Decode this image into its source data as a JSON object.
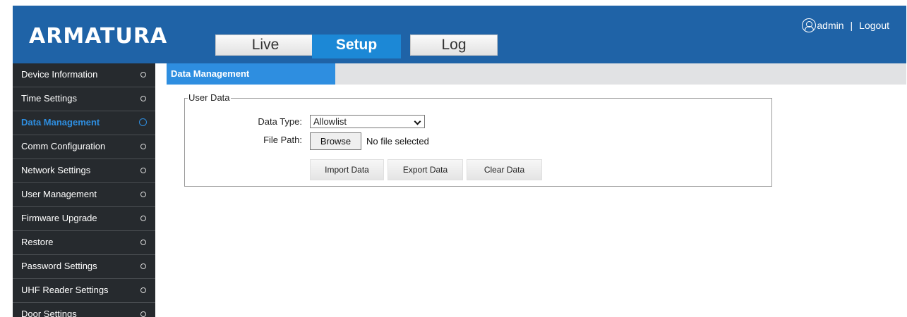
{
  "header": {
    "logo": "ARMATURA",
    "tabs": [
      {
        "label": "Live"
      },
      {
        "label": "Setup"
      },
      {
        "label": "Log"
      }
    ],
    "user": "admin",
    "separator": "|",
    "logout": "Logout"
  },
  "sidebar": {
    "items": [
      {
        "label": "Device Information"
      },
      {
        "label": "Time Settings"
      },
      {
        "label": "Data Management"
      },
      {
        "label": "Comm Configuration"
      },
      {
        "label": "Network Settings"
      },
      {
        "label": "User Management"
      },
      {
        "label": "Firmware Upgrade"
      },
      {
        "label": "Restore"
      },
      {
        "label": "Password Settings"
      },
      {
        "label": "UHF Reader Settings"
      },
      {
        "label": "Door Settings"
      }
    ],
    "active_index": 2
  },
  "content": {
    "title": "Data Management",
    "user_data": {
      "legend": "User Data",
      "data_type_label": "Data Type:",
      "data_type_value": "Allowlist",
      "file_path_label": "File Path:",
      "browse_label": "Browse",
      "file_status": "No file selected",
      "import_label": "Import Data",
      "export_label": "Export Data",
      "clear_label": "Clear Data"
    }
  },
  "colors": {
    "header_bg": "#1f63a7",
    "accent": "#2e8ee0",
    "sidebar_bg": "#262a2e"
  }
}
